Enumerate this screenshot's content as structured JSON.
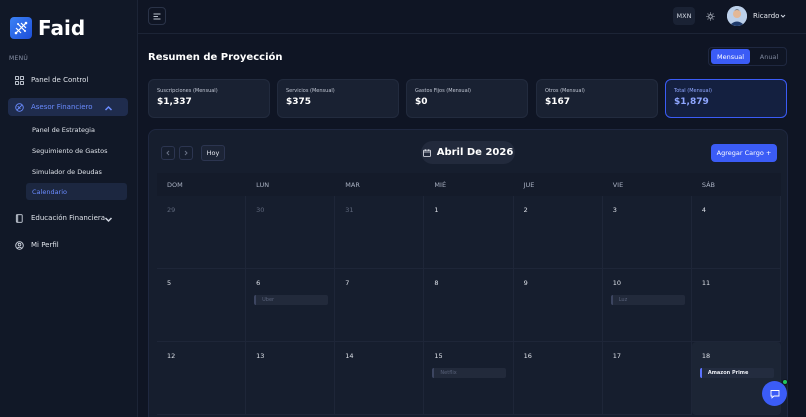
{
  "app": {
    "name": "Faid"
  },
  "sidebar": {
    "menu_label": "MENÚ",
    "items": [
      {
        "label": "Panel de Control",
        "icon": "grid-icon"
      },
      {
        "label": "Asesor Financiero",
        "icon": "asesor-icon",
        "active": true,
        "sub": [
          {
            "label": "Panel de Estrategia"
          },
          {
            "label": "Seguimiento de Gastos"
          },
          {
            "label": "Simulador de Deudas"
          },
          {
            "label": "Calendario",
            "active": true
          }
        ]
      },
      {
        "label": "Educación Financiera",
        "icon": "book-icon"
      },
      {
        "label": "Mi Perfil",
        "icon": "user-icon"
      }
    ]
  },
  "topbar": {
    "currency": "MXN",
    "user_name": "Ricardo"
  },
  "page": {
    "title": "Resumen de Proyección",
    "toggle_on": "Mensual",
    "toggle_off": "Anual"
  },
  "cards": [
    {
      "label": "Suscripciones (Mensual)",
      "value": "$1,337"
    },
    {
      "label": "Servicios (Mensual)",
      "value": "$375"
    },
    {
      "label": "Gastos Fijos (Mensual)",
      "value": "$0"
    },
    {
      "label": "Otros (Mensual)",
      "value": "$167"
    },
    {
      "label": "Total (Mensual)",
      "value": "$1,879"
    }
  ],
  "calendar": {
    "today_label": "Hoy",
    "month_label": "Abril De 2026",
    "add_label": "Agregar Cargo +",
    "weekdays": [
      "DOM",
      "LUN",
      "MAR",
      "MIÉ",
      "JUE",
      "VIE",
      "SÁB"
    ],
    "weeks": [
      [
        {
          "day": "29",
          "muted": true
        },
        {
          "day": "30",
          "muted": true
        },
        {
          "day": "31",
          "muted": true
        },
        {
          "day": "1"
        },
        {
          "day": "2"
        },
        {
          "day": "3"
        },
        {
          "day": "4"
        }
      ],
      [
        {
          "day": "5"
        },
        {
          "day": "6",
          "event": "Uber"
        },
        {
          "day": "7"
        },
        {
          "day": "8"
        },
        {
          "day": "9"
        },
        {
          "day": "10",
          "event": "Luz"
        },
        {
          "day": "11"
        }
      ],
      [
        {
          "day": "12"
        },
        {
          "day": "13"
        },
        {
          "day": "14"
        },
        {
          "day": "15",
          "event": "Netflix"
        },
        {
          "day": "16"
        },
        {
          "day": "17"
        },
        {
          "day": "18",
          "event": "Amazon Prime",
          "highlight": true
        }
      ]
    ]
  },
  "colors": {
    "accent": "#3b5cf6",
    "background": "#0f1524",
    "sidebar": "#111827",
    "online": "#22c55e"
  }
}
